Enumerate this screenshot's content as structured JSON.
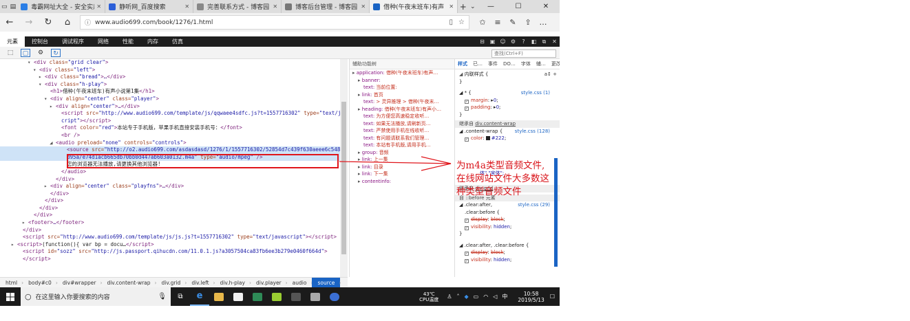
{
  "browser": {
    "tabs": [
      {
        "title": "毒霸网址大全 - 安全实用",
        "color": "#2a7ee6"
      },
      {
        "title": "静听网_百度搜索",
        "color": "#2c5fd8"
      },
      {
        "title": "完善联系方式 - 博客园",
        "color": "#888888"
      },
      {
        "title": "博客后台管理 - 博客园",
        "color": "#777777"
      },
      {
        "title": "借种(午夜末班车)有声",
        "color": "#1a64c4"
      }
    ],
    "url": "www.audio699.com/book/1276/1.html"
  },
  "devtools": {
    "tabs": [
      "元素",
      "控制台",
      "调试程序",
      "网络",
      "性能",
      "内存",
      "仿真"
    ],
    "search_placeholder": "查找(Ctrl+F)",
    "dom_lines": [
      {
        "i": 5,
        "t": "▾",
        "html": "<span class='tg'>&lt;div</span> <span class='at'>class=</span><span class='av'>\"grid clear\"</span><span class='tg'>&gt;</span>"
      },
      {
        "i": 6,
        "t": "▾",
        "html": "<span class='tg'>&lt;div</span> <span class='at'>class=</span><span class='av'>\"left\"</span><span class='tg'>&gt;</span>"
      },
      {
        "i": 7,
        "t": "▸",
        "html": "<span class='tg'>&lt;div</span> <span class='at'>class=</span><span class='av'>\"bread\"</span><span class='tg'>&gt;</span>…<span class='tg'>&lt;/div&gt;</span>"
      },
      {
        "i": 7,
        "t": "▾",
        "html": "<span class='tg'>&lt;div</span> <span class='at'>class=</span><span class='av'>\"h-play\"</span><span class='tg'>&gt;</span>"
      },
      {
        "i": 8,
        "t": "",
        "html": "<span class='tg'>&lt;h1&gt;</span><span class='tx'>借种(午夜末班车)有声小说第1集</span><span class='tg'>&lt;/h1&gt;</span>"
      },
      {
        "i": 8,
        "t": "▾",
        "html": "<span class='tg'>&lt;div</span> <span class='at'>align=</span><span class='av'>\"center\"</span> <span class='at'>class=</span><span class='av'>\"player\"</span><span class='tg'>&gt;</span>"
      },
      {
        "i": 9,
        "t": "▸",
        "html": "<span class='tg'>&lt;div</span> <span class='at'>align=</span><span class='av'>\"center\"</span><span class='tg'>&gt;</span>…<span class='tg'>&lt;/div&gt;</span>"
      },
      {
        "i": 10,
        "t": "",
        "html": "<span class='tg'>&lt;script</span> <span class='at'>src=</span><span class='av'>\"http://www.audio699.com/template/js/qqwaee4sdfc.js?t=1557716302\"</span> <span class='at'>type=</span><span class='av'>\"text/javas</span>"
      },
      {
        "i": 10,
        "t": "",
        "html": "<span class='av'>cript\"</span><span class='tg'>&gt;&lt;/script&gt;</span>"
      },
      {
        "i": 10,
        "t": "",
        "html": "<span class='tg'>&lt;font</span> <span class='at'>color=</span><span class='av'>\"red\"</span><span class='tg'>&gt;</span><span class='tx'>本站专于手机版，苹果手机直接安装手机号：</span><span class='tg'>&lt;/font&gt;</span>"
      },
      {
        "i": 10,
        "t": "",
        "html": "<span class='tg'>&lt;br /&gt;</span>"
      },
      {
        "i": 9,
        "t": "◢",
        "html": "<span class='tg'>&lt;audio</span> <span class='at'>preload=</span><span class='av'>\"none\"</span> <span class='at'>controls=</span><span class='av'>\"controls\"</span><span class='tg'>&gt;</span>"
      },
      {
        "i": 11,
        "t": "",
        "sel": true,
        "html": "<span class='tg'>&lt;source</span> <span class='at'>src=</span><span class='av'>\"http://o2.audio699.com/asdasdasd/1276/1/1557716302/52854d7c439f630aeee6c5481f6c</span>"
      },
      {
        "i": 11,
        "t": "",
        "sel": true,
        "html": "<span class='av'>d95a/e74d1acb665db70bb0d447ab603a0132.m4a\"</span> <span class='at'>type=</span><span class='av'>\"audio/mpeg\"</span> <span class='tg'>/&gt;</span>"
      },
      {
        "i": 11,
        "t": "",
        "html": "<span class='tx'>您的浏览器无法播放,请更换其他浏览器!</span>"
      },
      {
        "i": 10,
        "t": "",
        "html": "<span class='tg'>&lt;/audio&gt;</span>"
      },
      {
        "i": 9,
        "t": "",
        "html": "<span class='tg'>&lt;/div&gt;</span>"
      },
      {
        "i": 8,
        "t": "▸",
        "html": "<span class='tg'>&lt;div</span> <span class='at'>align=</span><span class='av'>\"center\"</span> <span class='at'>class=</span><span class='av'>\"playfns\"</span><span class='tg'>&gt;</span>…<span class='tg'>&lt;/div&gt;</span>"
      },
      {
        "i": 8,
        "t": "",
        "html": "<span class='tg'>&lt;/div&gt;</span>"
      },
      {
        "i": 7,
        "t": "",
        "html": "<span class='tg'>&lt;/div&gt;</span>"
      },
      {
        "i": 6,
        "t": "",
        "html": "<span class='tg'>&lt;/div&gt;</span>"
      },
      {
        "i": 5,
        "t": "",
        "html": "<span class='tg'>&lt;/div&gt;</span>"
      },
      {
        "i": 4,
        "t": "▸",
        "html": "<span class='tg'>&lt;footer&gt;</span>…<span class='tg'>&lt;/footer&gt;</span>"
      },
      {
        "i": 3,
        "t": "",
        "html": "<span class='tg'>&lt;/div&gt;</span>"
      },
      {
        "i": 3,
        "t": "",
        "html": "<span class='tg'>&lt;script</span> <span class='at'>src=</span><span class='av'>\"http://www.audio699.com/template/js/js.js?t=1557716302\"</span> <span class='at'>type=</span><span class='av'>\"text/javascript\"</span><span class='tg'>&gt;&lt;/script&gt;</span>"
      },
      {
        "i": 2,
        "t": "▸",
        "html": "<span class='tg'>&lt;script&gt;</span><span class='tx'>(function(){ var bp = docu…</span><span class='tg'>&lt;/script&gt;</span>"
      },
      {
        "i": 3,
        "t": "",
        "html": "<span class='tg'>&lt;script</span> <span class='at'>id=</span><span class='av'>\"sozz\"</span> <span class='at'>src=</span><span class='av'>\"http://js.passport.qihucdn.com/11.0.1.js?a3057504ca83fb6ee3b279e0460f664d\"</span><span class='tg'>&gt;</span>"
      },
      {
        "i": 3,
        "t": "",
        "html": "<span class='tg'>&lt;/script&gt;</span>"
      }
    ],
    "acc": {
      "title": "辅助功能树",
      "lines": [
        {
          "i": 0,
          "k": "application:",
          "v": "借种(午夜末班车)有声…"
        },
        {
          "i": 1,
          "k": "banner:",
          "v": ""
        },
        {
          "i": 2,
          "k": "text:",
          "v": "当前位置:"
        },
        {
          "i": 1,
          "k": "link:",
          "v": "首页"
        },
        {
          "i": 2,
          "k": "text:",
          "v": "> 灵异推理 > 借种(午夜末…"
        },
        {
          "i": 1,
          "k": "heading:",
          "v": "借种(午夜末班车)有声小…"
        },
        {
          "i": 2,
          "k": "text:",
          "v": "为方便您高速稳定收听…"
        },
        {
          "i": 2,
          "k": "text:",
          "v": "如果无法播放,请刷新页…"
        },
        {
          "i": 2,
          "k": "text:",
          "v": "严禁使用手机在线收听…"
        },
        {
          "i": 2,
          "k": "text:",
          "v": "有问题请联系我们管理…"
        },
        {
          "i": 2,
          "k": "text:",
          "v": "本站有手机版,请用手机…"
        },
        {
          "i": 1,
          "k": "group:",
          "v": "音频"
        },
        {
          "i": 1,
          "k": "link:",
          "v": "上一集"
        },
        {
          "i": 1,
          "k": "link:",
          "v": "目录"
        },
        {
          "i": 1,
          "k": "link:",
          "v": "下一集"
        },
        {
          "i": 1,
          "k": "contentinfo:",
          "v": ""
        }
      ]
    },
    "styles": {
      "tabs": [
        "样式",
        "已…",
        "事件",
        "DO…",
        "字体",
        "辅…",
        "更改"
      ],
      "inline_label": "内联样式",
      "rule_star_src": "style.css (1)",
      "inherit1": "继承自",
      "inherit1_sel": "div.content-wrap",
      "rule2_selector": ".content-wrap",
      "rule2_src": "style.css (128)",
      "color_prop": "color",
      "color_val": "#222",
      "font_frag": "体\",\"宋体\";",
      "inherit2": "继承自",
      "inherit2_sel": "div.grid",
      "before_label": "自 ::before 元素",
      "rule3_src": "style.css (29)",
      "rule3_sel_a": ".clear:after,",
      "rule3_sel_b": ".clear:before",
      "rule4_sel": ".clear:after, .clear:before",
      "display_prop": "display",
      "display_val": "block",
      "visibility_prop": "visibility",
      "visibility_val": "hidden",
      "margin_prop": "margin",
      "margin_val": "0",
      "padding_prop": "padding",
      "padding_val": "0"
    },
    "breadcrumb": [
      "html",
      "body#c0",
      "div#wrapper",
      "div.content-wrap",
      "div.grid",
      "div.left",
      "div.h-play",
      "div.player",
      "audio",
      "source"
    ]
  },
  "taskbar": {
    "search_placeholder": "在这里输入你要搜索的内容",
    "temp": "43℃",
    "cpu": "CPU温度",
    "ime": "中",
    "time": "10:58",
    "date": "2019/5/13"
  },
  "annotation": {
    "line1": "为m4a类型音频文件,",
    "line2": "在线网站文件大多数这",
    "line3": "种类型音频文件"
  },
  "colors": {
    "accent": "#1a64c4",
    "annotation": "#d9141a"
  }
}
